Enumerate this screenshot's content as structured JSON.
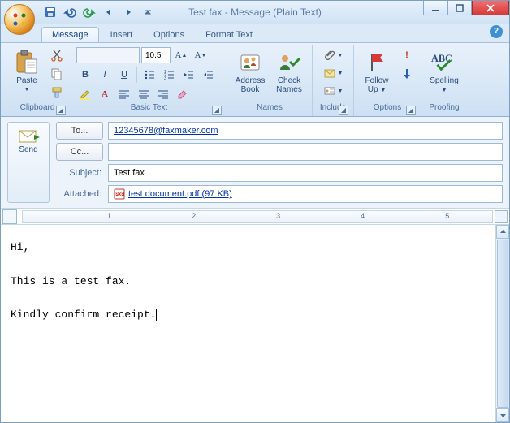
{
  "window": {
    "title": "Test fax - Message (Plain Text)"
  },
  "qat": {
    "save": "Save",
    "undo": "Undo",
    "redo": "Redo",
    "prev": "Previous",
    "next": "Next"
  },
  "tabs": {
    "items": [
      {
        "label": "Message",
        "active": true
      },
      {
        "label": "Insert",
        "active": false
      },
      {
        "label": "Options",
        "active": false
      },
      {
        "label": "Format Text",
        "active": false
      }
    ]
  },
  "ribbon": {
    "clipboard": {
      "paste": "Paste",
      "label": "Clipboard"
    },
    "basictext": {
      "font_name": "",
      "font_size": "10.5",
      "label": "Basic Text"
    },
    "names": {
      "addressbook_l1": "Address",
      "addressbook_l2": "Book",
      "checknames_l1": "Check",
      "checknames_l2": "Names",
      "label": "Names"
    },
    "include": {
      "label": "Include"
    },
    "options": {
      "followup_l1": "Follow",
      "followup_l2": "Up",
      "label": "Options"
    },
    "proofing": {
      "spelling": "Spelling",
      "label": "Proofing"
    }
  },
  "header": {
    "send": "Send",
    "to_label": "To...",
    "to_value": "12345678@faxmaker.com",
    "cc_label": "Cc...",
    "cc_value": "",
    "subject_label": "Subject:",
    "subject_value": "Test fax",
    "attached_label": "Attached:",
    "attached_name": "test document.pdf (97 KB)"
  },
  "ruler": {
    "n1": "1",
    "n2": "2",
    "n3": "3",
    "n4": "4",
    "n5": "5"
  },
  "body": {
    "text": "Hi,\n\nThis is a test fax.\n\nKindly confirm receipt."
  }
}
